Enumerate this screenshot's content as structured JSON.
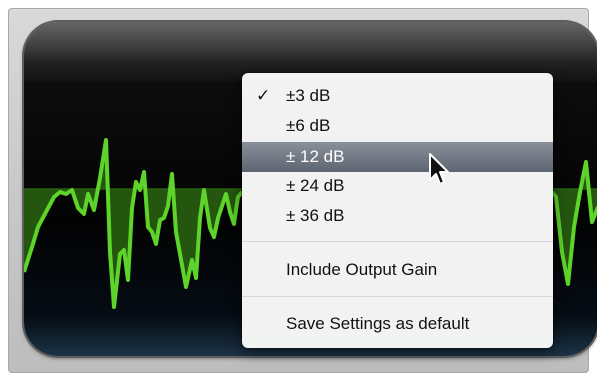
{
  "menu": {
    "check_mark": "✓",
    "items": [
      {
        "label": "±3 dB",
        "checked": true
      },
      {
        "label": "±6 dB",
        "checked": false
      },
      {
        "label": "± 12 dB",
        "checked": false,
        "highlighted": true
      },
      {
        "label": "± 24 dB",
        "checked": false
      },
      {
        "label": "± 36 dB",
        "checked": false
      }
    ],
    "include_output_gain_label": "Include Output Gain",
    "save_settings_label": "Save Settings as default"
  },
  "colors": {
    "waveform": "#5ed42a",
    "waveform_fill": "#2f6f14",
    "highlight": "#6b7380"
  },
  "icons": {
    "cursor": "arrow-pointer-icon"
  }
}
